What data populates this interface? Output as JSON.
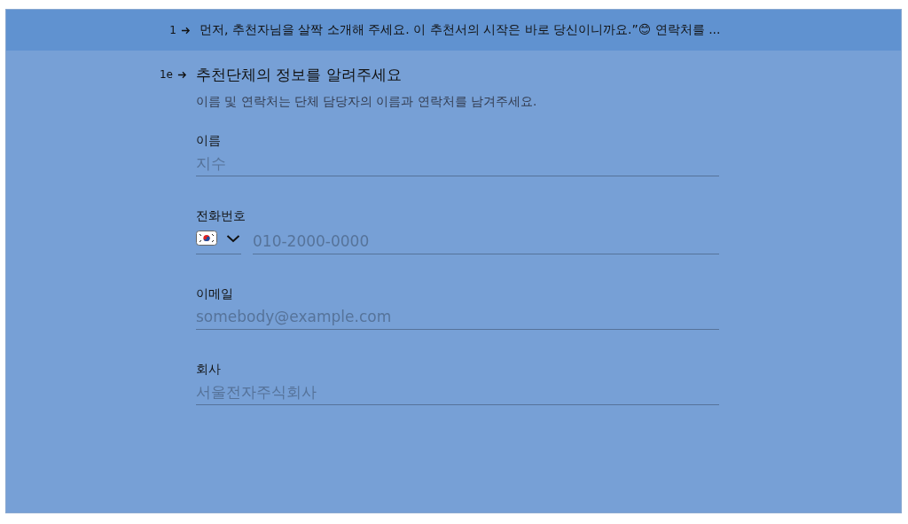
{
  "header": {
    "number": "1",
    "text": "먼저, 추천자님을 살짝 소개해 주세요. 이 추천서의 시작은 바로 당신이니까요.”😊 연락처를 ..."
  },
  "question": {
    "number": "1e",
    "title": "추천단체의 정보를 알려주세요",
    "description": "이름 및 연락처는 단체 담당자의 이름과 연락처를 남겨주세요."
  },
  "fields": [
    {
      "kind": "text",
      "label": "이름",
      "placeholder": "지수"
    },
    {
      "kind": "phone",
      "label": "전화번호",
      "placeholder": "010-2000-0000"
    },
    {
      "kind": "text",
      "label": "이메일",
      "placeholder": "somebody@example.com"
    },
    {
      "kind": "text",
      "label": "회사",
      "placeholder": "서울전자주식회사"
    }
  ]
}
